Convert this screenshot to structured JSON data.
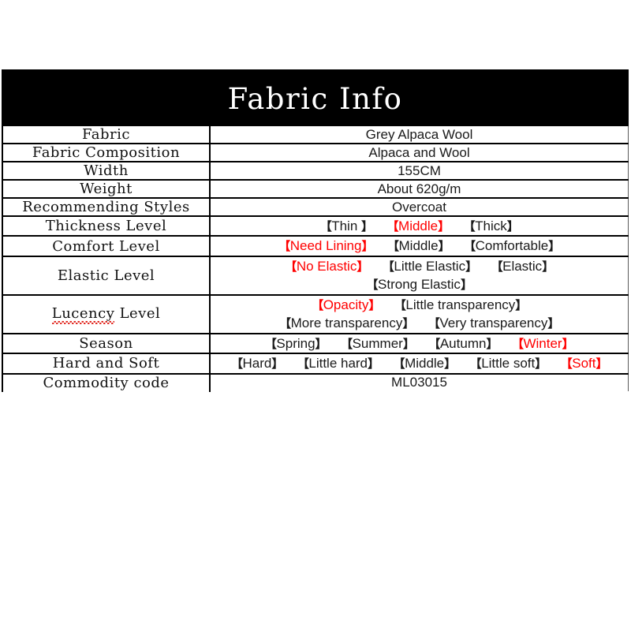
{
  "header": {
    "title": "Fabric Info",
    "background_color": "#000000",
    "text_color": "#ffffff"
  },
  "colors": {
    "selected": "#ff0000",
    "text": "#1a1a1a",
    "border": "#000000",
    "background": "#ffffff",
    "spellcheck_underline": "#e0241c"
  },
  "brackets": {
    "open": "【",
    "close": "】"
  },
  "rows": [
    {
      "label": "Fabric",
      "type": "text",
      "value": "Grey Alpaca Wool"
    },
    {
      "label": "Fabric Composition",
      "type": "text",
      "value": "Alpaca and Wool"
    },
    {
      "label": "Width",
      "type": "text",
      "value": "155CM"
    },
    {
      "label": "Weight",
      "type": "text",
      "value": "About 620g/m"
    },
    {
      "label": "Recommending Styles",
      "type": "text",
      "value": "Overcoat"
    },
    {
      "label": "Thickness Level",
      "type": "options",
      "lines": [
        [
          {
            "text": "Thin ",
            "selected": false
          },
          {
            "text": "Middle",
            "selected": true
          },
          {
            "text": "Thick",
            "selected": false
          }
        ]
      ]
    },
    {
      "label": "Comfort Level",
      "type": "options",
      "lines": [
        [
          {
            "text": "Need Lining",
            "selected": true
          },
          {
            "text": "Middle",
            "selected": false
          },
          {
            "text": "Comfortable",
            "selected": false
          }
        ]
      ]
    },
    {
      "label": "Elastic Level",
      "type": "options",
      "lines": [
        [
          {
            "text": "No Elastic",
            "selected": true
          },
          {
            "text": "Little Elastic",
            "selected": false
          },
          {
            "text": "Elastic",
            "selected": false
          }
        ],
        [
          {
            "text": "Strong Elastic",
            "selected": false
          }
        ]
      ]
    },
    {
      "label": "Lucency Level",
      "label_spellchecked_word": "Lucency",
      "label_rest": " Level",
      "type": "options",
      "lines": [
        [
          {
            "text": "Opacity",
            "selected": true
          },
          {
            "text": "Little transparency",
            "selected": false
          }
        ],
        [
          {
            "text": "More transparency",
            "selected": false
          },
          {
            "text": "Very transparency",
            "selected": false
          }
        ]
      ]
    },
    {
      "label": "Season",
      "type": "options",
      "lines": [
        [
          {
            "text": "Spring",
            "selected": false
          },
          {
            "text": "Summer",
            "selected": false
          },
          {
            "text": "Autumn",
            "selected": false
          },
          {
            "text": "Winter",
            "selected": true
          }
        ]
      ]
    },
    {
      "label": "Hard and Soft",
      "type": "options",
      "lines": [
        [
          {
            "text": "Hard",
            "selected": false
          },
          {
            "text": "Little hard",
            "selected": false
          },
          {
            "text": "Middle",
            "selected": false
          },
          {
            "text": "Little soft",
            "selected": false
          },
          {
            "text": "Soft",
            "selected": true
          }
        ]
      ]
    },
    {
      "label": "Commodity code",
      "type": "text",
      "value": "ML03015"
    }
  ]
}
